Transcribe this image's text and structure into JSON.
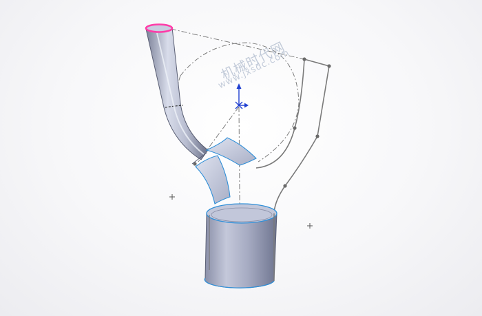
{
  "viewport": {
    "background": "#f6f6f8",
    "watermark": {
      "line1": "机械时代网",
      "line2": "www.jxsdc.com"
    }
  },
  "model": {
    "surface_fill": "#aab0c8",
    "edge_color": "#5a5f74",
    "selected_edge_color": "#ff3ca8",
    "highlight_edge_color": "#2f8fd8",
    "sketch_color": "#7a7a7a",
    "origin_color": "#1f3fd1",
    "icons": [
      "origin-triad-icon",
      "sketch-point-icon"
    ]
  }
}
